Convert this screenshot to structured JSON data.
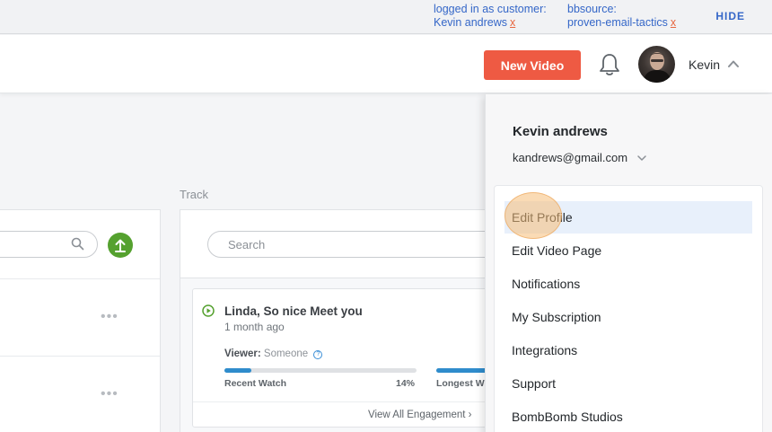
{
  "debug": {
    "logged_in_label": "logged in as customer:",
    "customer_name": "Kevin andrews",
    "bbsource_label": "bbsource:",
    "bbsource_value": "proven-email-tactics",
    "remove_mark": "x",
    "hide_label": "HIDE"
  },
  "header": {
    "new_video_label": "New Video",
    "user_first_name": "Kevin"
  },
  "track": {
    "section_label": "Track",
    "search_placeholder": "Search",
    "card": {
      "title": "Linda, So nice Meet you",
      "time": "1 month ago",
      "viewer_label": "Viewer:",
      "viewer_value": "Someone",
      "recent_watch_label": "Recent Watch",
      "recent_watch_percent": "14%",
      "recent_watch_fraction": 0.14,
      "longest_watch_label": "Longest W",
      "view_all_label": "View All Engagement ›"
    }
  },
  "left_panel": {
    "row_menu_dots": "•••"
  },
  "dropdown": {
    "full_name": "Kevin andrews",
    "email": "kandrews@gmail.com",
    "items": [
      {
        "label": "Edit Profile"
      },
      {
        "label": "Edit Video Page"
      },
      {
        "label": "Notifications"
      },
      {
        "label": "My Subscription"
      },
      {
        "label": "Integrations"
      },
      {
        "label": "Support"
      },
      {
        "label": "BombBomb Studios"
      }
    ]
  },
  "colors": {
    "accent": "#ee5a43",
    "link": "#3567c8",
    "progress": "#2f8ccc",
    "upload": "#55a12f"
  }
}
